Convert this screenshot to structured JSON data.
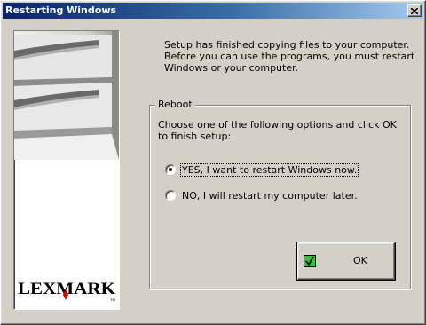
{
  "window": {
    "title": "Restarting Windows"
  },
  "titlebar": {
    "close_icon": "close-icon"
  },
  "sidebar": {
    "logo_text": "LEXMARK",
    "logo_tm": "TM",
    "art_icon": "printer-trays-illustration"
  },
  "message": "Setup has finished copying files to your computer.  Before you can use the programs, you must restart Windows or your computer.",
  "reboot": {
    "label": "Reboot",
    "description": "Choose one of the following options and click OK to finish setup:",
    "options": [
      {
        "label": "YES, I want to restart Windows now.",
        "selected": true
      },
      {
        "label": "NO, I will restart my computer later.",
        "selected": false
      }
    ]
  },
  "ok_button": {
    "label": "OK",
    "icon": "green-check-icon"
  }
}
